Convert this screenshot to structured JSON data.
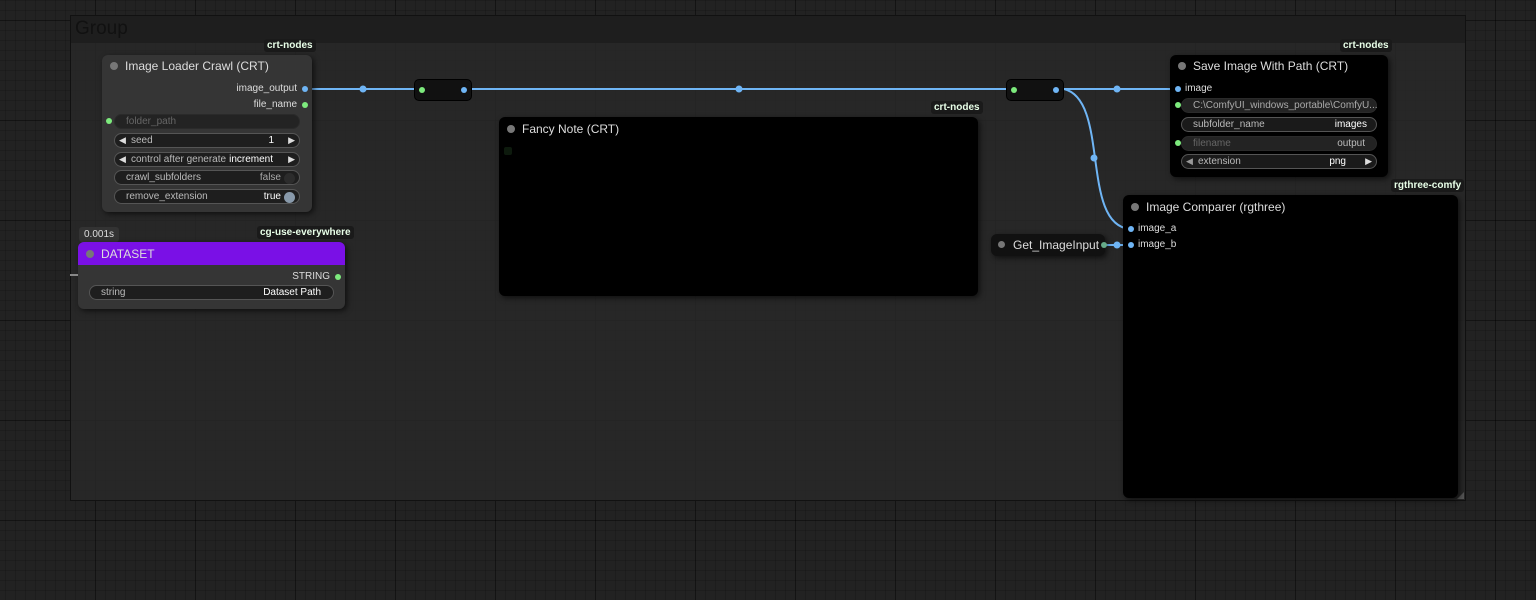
{
  "group": {
    "title": "Group"
  },
  "nodes": {
    "image_loader": {
      "badge": "crt-nodes",
      "title": "Image Loader Crawl (CRT)",
      "outputs": [
        "image_output",
        "file_name"
      ],
      "widgets": {
        "folder_path": {
          "label": "folder_path"
        },
        "seed": {
          "label": "seed",
          "value": "1"
        },
        "control": {
          "label": "control after generate",
          "value": "increment"
        },
        "crawl": {
          "label": "crawl_subfolders",
          "value": "false"
        },
        "remove": {
          "label": "remove_extension",
          "value": "true"
        }
      }
    },
    "dataset": {
      "timing": "0.001s",
      "badge": "cg-use-everywhere",
      "title": "DATASET",
      "title_color": "#7a10e6",
      "output": "STRING",
      "widget": {
        "label": "string",
        "value": "Dataset Path"
      }
    },
    "fancy_note": {
      "badge": "crt-nodes",
      "title": "Fancy Note (CRT)"
    },
    "save_image": {
      "badge": "crt-nodes",
      "title": "Save Image With Path (CRT)",
      "input": "image",
      "widgets": {
        "path": {
          "label": "C:\\ComfyUI_windows_portable\\ComfyU..."
        },
        "subfolder": {
          "label": "subfolder_name",
          "value": "images"
        },
        "filename": {
          "label": "filename",
          "value": "output"
        },
        "extension": {
          "label": "extension",
          "value": "png"
        }
      }
    },
    "get_image": {
      "title": "Get_ImageInput"
    },
    "comparer": {
      "badge": "rgthree-comfy",
      "title": "Image Comparer (rgthree)",
      "inputs": [
        "image_a",
        "image_b"
      ]
    }
  },
  "link_color": "#6fb5f5",
  "icons": {
    "arrow_left": "◀",
    "arrow_right": "▶"
  }
}
